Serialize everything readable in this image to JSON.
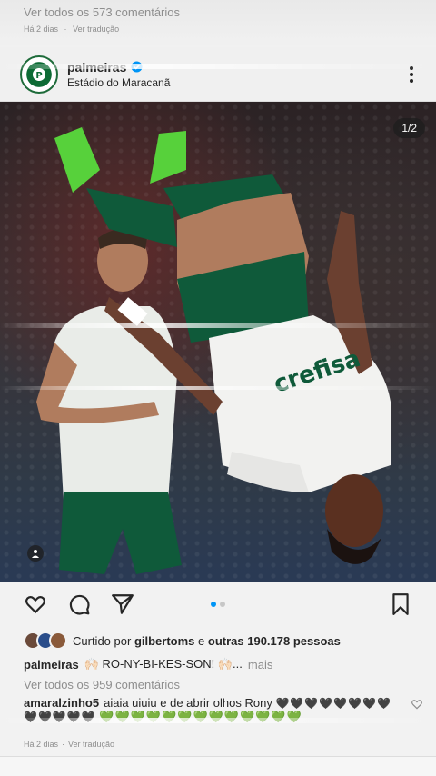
{
  "previous_post": {
    "view_comments": "Ver todos os 573 comentários",
    "time_ago": "Há 2 dias",
    "separator": "·",
    "translate": "Ver tradução"
  },
  "post": {
    "username": "palmeiras",
    "location": "Estádio do Maracanã",
    "counter": "1/2",
    "dots_total": 2,
    "dots_active": 1,
    "likes": {
      "prefix": "Curtido por",
      "first_user": "gilbertoms",
      "middle": "e",
      "others": "outras 190.178 pessoas"
    },
    "caption": {
      "username": "palmeiras",
      "text": "🙌🏻 RO-NY-BI-KES-SON! 🙌🏻...",
      "more": "mais"
    },
    "view_comments": "Ver todos os 959 comentários",
    "top_comment": {
      "username": "amaralzinho5",
      "text": "aiaia uiuiu e de abrir olhos Rony",
      "dark_hearts": "🖤🖤🖤🖤🖤🖤🖤🖤",
      "gray_hearts": "🖤🖤🖤🖤🖤",
      "green_hearts": "💚💚💚💚💚💚💚💚💚💚💚💚💚"
    },
    "time_ago": "Há 2 dias",
    "separator": "·",
    "translate": "Ver tradução"
  },
  "colors": {
    "accent": "#0095f6",
    "brand_green": "#0d6b35"
  },
  "icons": [
    "heart-icon",
    "comment-icon",
    "share-icon",
    "bookmark-icon",
    "more-icon",
    "verified-icon",
    "person-tag-icon",
    "small-heart-icon"
  ]
}
